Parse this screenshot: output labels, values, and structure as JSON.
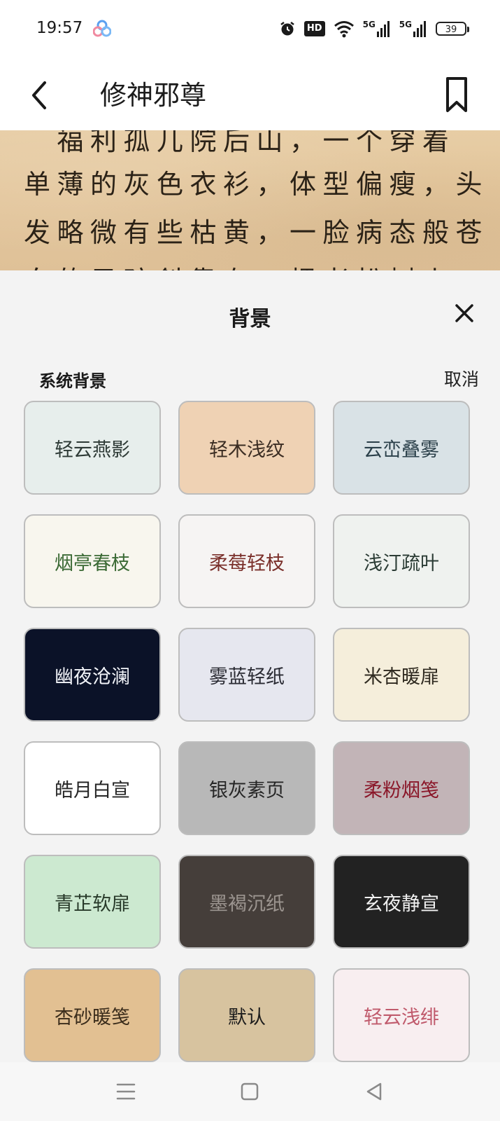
{
  "status_bar": {
    "time": "19:57",
    "notification_icon": "app-cluster-icon",
    "hd_label": "HD",
    "net1": "5G",
    "net2": "5G",
    "battery": "39"
  },
  "header": {
    "title": "修神邪尊",
    "back_icon": "chevron-left-icon",
    "bookmark_icon": "bookmark-icon"
  },
  "reading_preview": {
    "lines": [
      "　福利孤儿院后山，一个穿着",
      "单薄的灰色衣衫，体型偏瘦，头",
      "发略微有些枯黄，一脸病态般苍",
      "白的男孩斜靠在一棵老松树上"
    ]
  },
  "sheet": {
    "title": "背景",
    "section_label": "系统背景",
    "cancel_label": "取消",
    "close_icon": "close-icon",
    "tiles": [
      {
        "label": "轻云燕影",
        "bg": "#e7eeec",
        "fg": "#2e3a36"
      },
      {
        "label": "轻木浅纹",
        "bg": "#efd2b4",
        "fg": "#3a2c22"
      },
      {
        "label": "云峦叠雾",
        "bg": "#d9e2e6",
        "fg": "#2a3f49"
      },
      {
        "label": "烟亭春枝",
        "bg": "#f8f6ee",
        "fg": "#3b6a35"
      },
      {
        "label": "柔莓轻枝",
        "bg": "#f6f4f3",
        "fg": "#7a2f2a"
      },
      {
        "label": "浅汀疏叶",
        "bg": "#eff2ef",
        "fg": "#2b3c35"
      },
      {
        "label": "幽夜沧澜",
        "bg": "#0b1228",
        "fg": "#f1f3f8"
      },
      {
        "label": "雾蓝轻纸",
        "bg": "#e6e7ef",
        "fg": "#2a2b33"
      },
      {
        "label": "米杏暖扉",
        "bg": "#f5eedb",
        "fg": "#2f2a20"
      },
      {
        "label": "皓月白宣",
        "bg": "#ffffff",
        "fg": "#262626"
      },
      {
        "label": "银灰素页",
        "bg": "#b8b8b8",
        "fg": "#262626"
      },
      {
        "label": "柔粉烟笺",
        "bg": "#c2b4b7",
        "fg": "#8a1628"
      },
      {
        "label": "青芷软扉",
        "bg": "#cce9d0",
        "fg": "#283a2a"
      },
      {
        "label": "墨褐沉纸",
        "bg": "#453e3a",
        "fg": "#9c9590"
      },
      {
        "label": "玄夜静宣",
        "bg": "#222222",
        "fg": "#f1f1f1"
      },
      {
        "label": "杏砂暖笺",
        "bg": "#e2c092",
        "fg": "#3b2d1c"
      },
      {
        "label": "默认",
        "bg": "#d7c39f",
        "fg": "#1c1c1c"
      },
      {
        "label": "轻云浅绯",
        "bg": "#f8eef0",
        "fg": "#c05a6c"
      }
    ]
  },
  "nav_bar": {
    "menu_icon": "menu-icon",
    "home_icon": "home-icon",
    "back_icon": "back-triangle-icon"
  }
}
